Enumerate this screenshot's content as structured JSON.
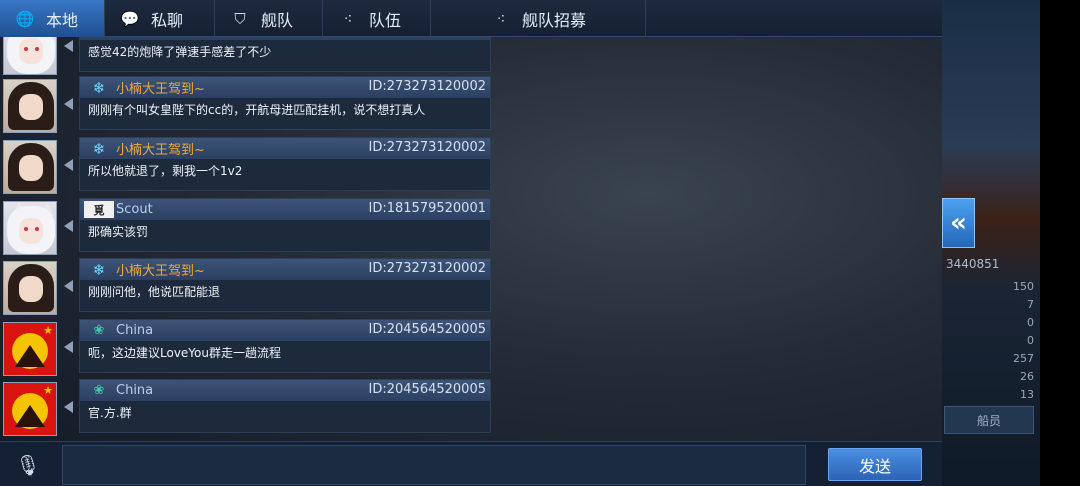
{
  "tabs": [
    {
      "label": "本地",
      "icon": "globe-icon"
    },
    {
      "label": "私聊",
      "icon": "chat-bubble-icon"
    },
    {
      "label": "舰队",
      "icon": "fleet-icon"
    },
    {
      "label": "队伍",
      "icon": "team-icon"
    },
    {
      "label": "舰队招募",
      "icon": "recruit-icon"
    }
  ],
  "messages": [
    {
      "avatar": "cat-girl",
      "name": "",
      "id": "",
      "text": "感觉42的炮降了弹速手感差了不少"
    },
    {
      "avatar": "dark-hair-girl",
      "name_icon": "snowflake-icon",
      "name": "小楠大王驾到~",
      "name_color": "#f0a83a",
      "id": "ID:273273120002",
      "text": "刚刚有个叫女皇陛下的cc的，开航母进匹配挂机，说不想打真人"
    },
    {
      "avatar": "dark-hair-girl",
      "name_icon": "snowflake-icon",
      "name": "小楠大王驾到~",
      "name_color": "#f0a83a",
      "id": "ID:273273120002",
      "text": "所以他就退了，剩我一个1v2"
    },
    {
      "avatar": "cat-girl",
      "name_icon": "scout-badge-icon",
      "name": "Scout",
      "name_color": "#b8d0ee",
      "id": "ID:181579520001",
      "text": "那确实该罚"
    },
    {
      "avatar": "dark-hair-girl",
      "name_icon": "snowflake-icon",
      "name": "小楠大王驾到~",
      "name_color": "#f0a83a",
      "id": "ID:273273120002",
      "text": "刚刚问他，他说匹配能退"
    },
    {
      "avatar": "china-flag",
      "name_icon": "china-badge-icon",
      "name": "China",
      "name_color": "#b8d0ee",
      "id": "ID:204564520005",
      "text": "呃，这边建议LoveYou群走一趟流程"
    },
    {
      "avatar": "china-flag",
      "name_icon": "china-badge-icon",
      "name": "China",
      "name_color": "#b8d0ee",
      "id": "ID:204564520005",
      "text": "官.方.群"
    }
  ],
  "input": {
    "placeholder": "",
    "send_label": "发送"
  },
  "right_panel": {
    "player_id": "3440851",
    "stats": [
      "150",
      "7",
      "0",
      "0",
      "257",
      "26",
      "13"
    ],
    "button_label": "船员"
  }
}
